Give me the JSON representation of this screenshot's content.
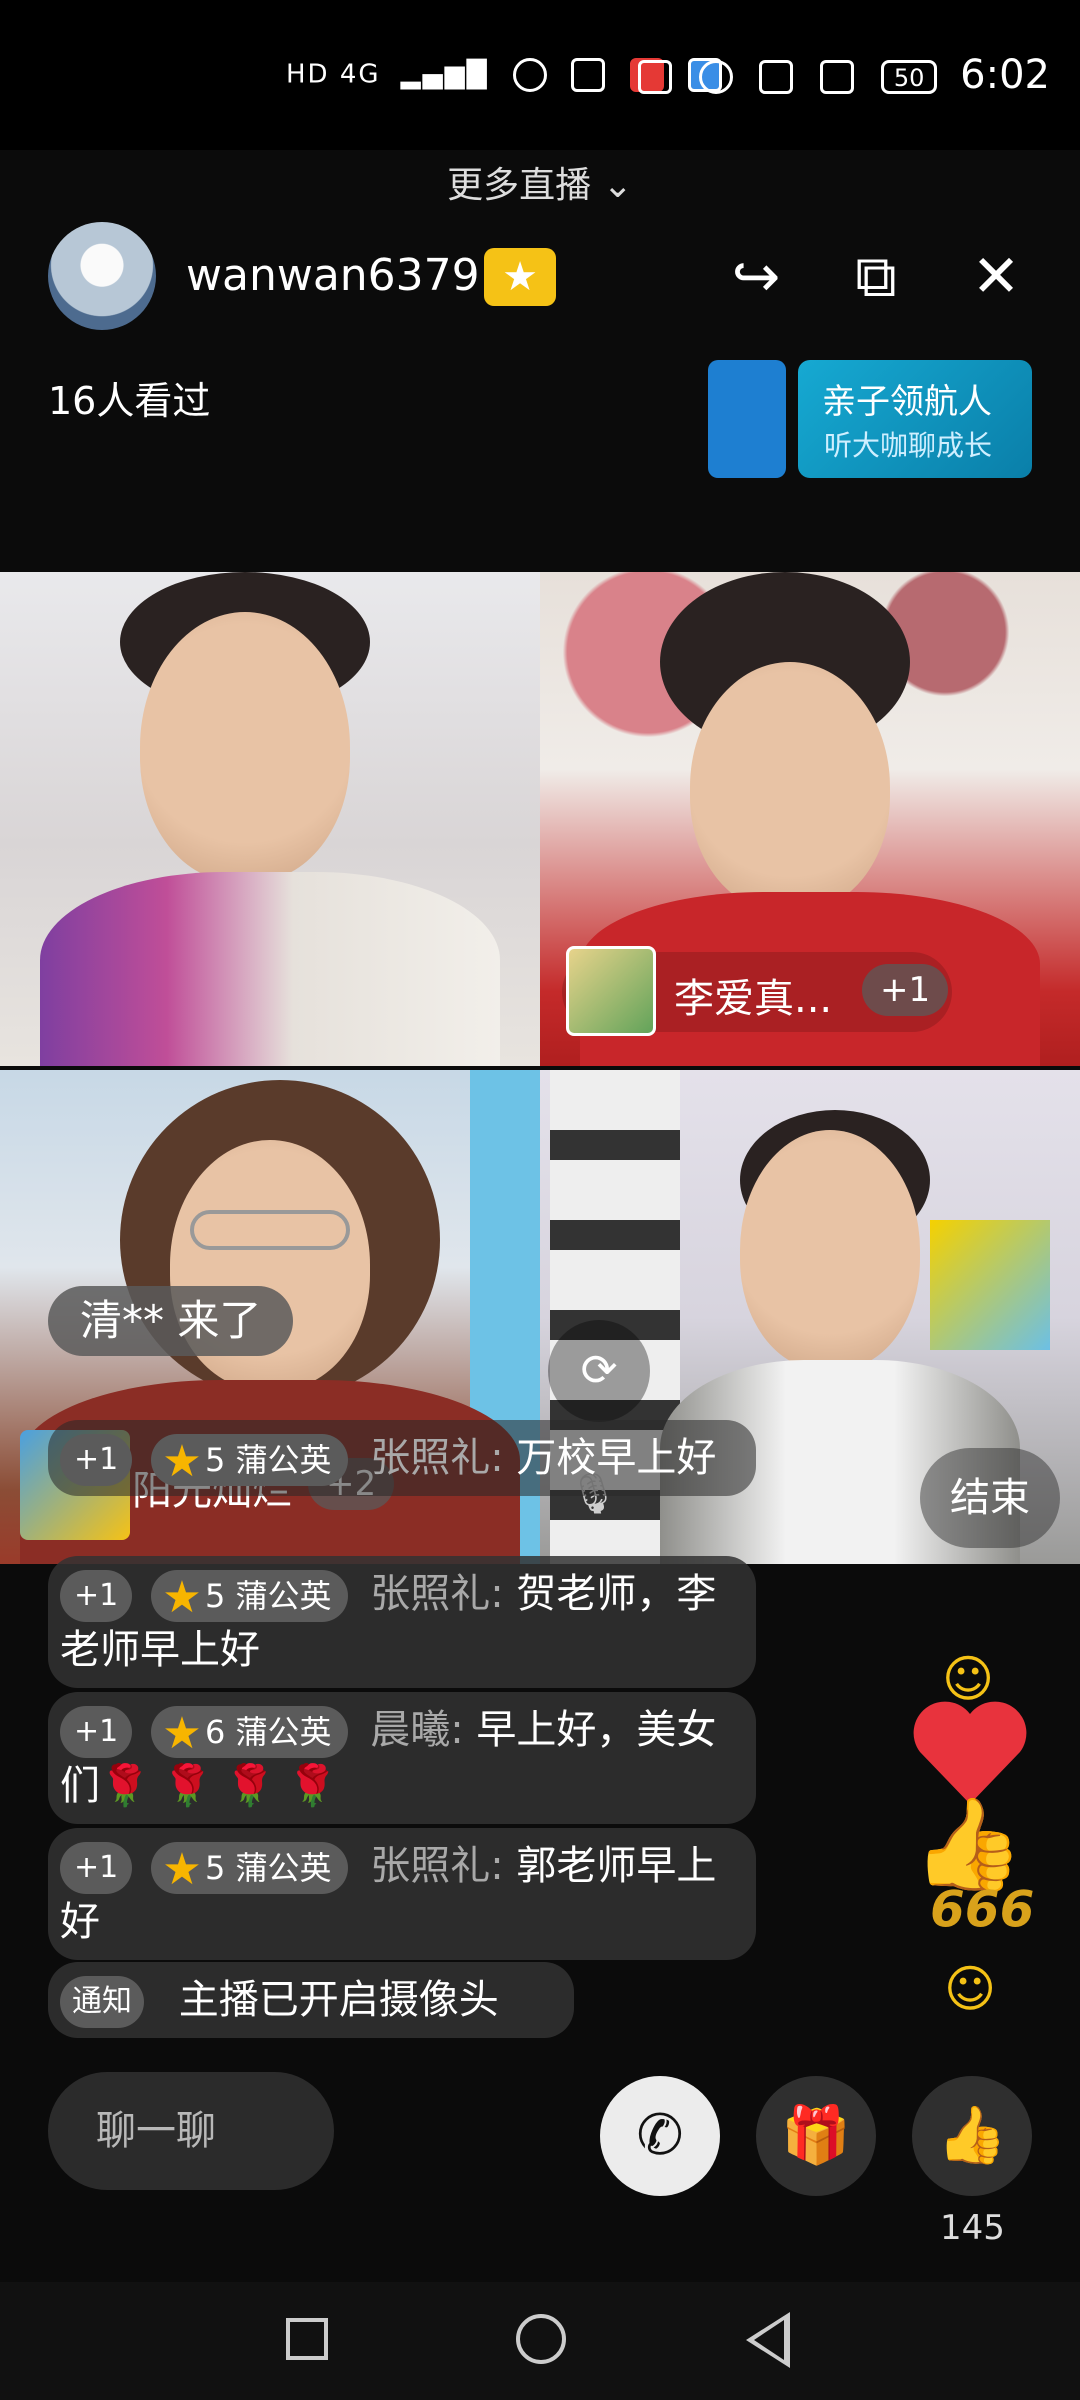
{
  "status_bar": {
    "left_icons": "HD 4G",
    "battery": "50",
    "time": "6:02"
  },
  "header": {
    "more_live_label": "更多直播",
    "host_name": "wanwan6379",
    "viewers": "16人看过",
    "banner": {
      "title": "亲子领航人",
      "subtitle": "听大咖聊成长"
    }
  },
  "tiles": [
    {
      "name": "",
      "plus": ""
    },
    {
      "name": "李爱真...",
      "plus": "+1"
    },
    {
      "name": "阳光灿烂",
      "plus": "+2"
    },
    {
      "name": "",
      "plus": ""
    }
  ],
  "end_button": "结束",
  "join_notice": "清** 来了",
  "chat_messages": [
    {
      "plus": "+1",
      "level": "5",
      "badge": "蒲公英",
      "speaker": "张照礼:",
      "text": "万校早上好"
    },
    {
      "plus": "+1",
      "level": "5",
      "badge": "蒲公英",
      "speaker": "张照礼:",
      "text": "贺老师，李老师早上好"
    },
    {
      "plus": "+1",
      "level": "6",
      "badge": "蒲公英",
      "speaker": "晨曦:",
      "text": "早上好，美女们🌹 🌹 🌹 🌹"
    },
    {
      "plus": "+1",
      "level": "5",
      "badge": "蒲公英",
      "speaker": "张照礼:",
      "text": "郭老师早上好"
    }
  ],
  "system_notice": {
    "tag": "通知",
    "text": "主播已开启摄像头"
  },
  "bottom": {
    "chat_placeholder": "聊一聊",
    "like_count": "145"
  },
  "decoration": {
    "number_sticker": "666"
  }
}
